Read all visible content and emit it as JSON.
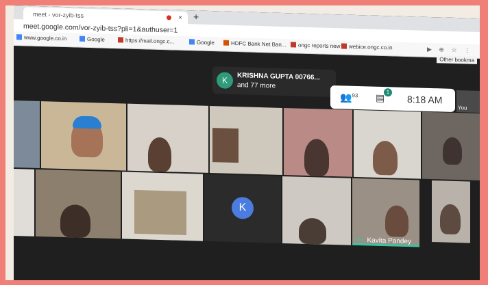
{
  "browser": {
    "tab_title": "meet - vor-zyib-tss",
    "url": "meet.google.com/vor-zyib-tss?pli=1&authuser=1",
    "new_tab": "+",
    "close": "×",
    "tray_icons": "▶ ⊕ ☆ ⋮",
    "bookmarks": [
      {
        "label": "www.google.co.in",
        "color": "#4285f4"
      },
      {
        "label": "Google",
        "color": "#4285f4"
      },
      {
        "label": "https://mail.ongc.c...",
        "color": "#c0392b"
      },
      {
        "label": "Google",
        "color": "#4285f4"
      },
      {
        "label": "HDFC Bank Net Ban...",
        "color": "#d35400"
      },
      {
        "label": "ongc reports new",
        "color": "#c0392b"
      },
      {
        "label": "webice.ongc.co.in",
        "color": "#c0392b"
      }
    ],
    "other_bookmarks": "Other bookma"
  },
  "meet": {
    "toast": {
      "avatar_letter": "K",
      "line1": "KRISHNA GUPTA 00766...",
      "line2": "and 77 more"
    },
    "people_count": "93",
    "chat_badge": "1",
    "time": "8:18 AM",
    "self_label": "You",
    "tiles": [
      {
        "avatar_letter": "K"
      },
      {
        "name": "Kavita Pandey",
        "speaking": true
      }
    ]
  },
  "colors": {
    "accent": "#33c8a0",
    "avatar_blue": "#4b7de0",
    "toast_avatar": "#2e9c7a"
  }
}
